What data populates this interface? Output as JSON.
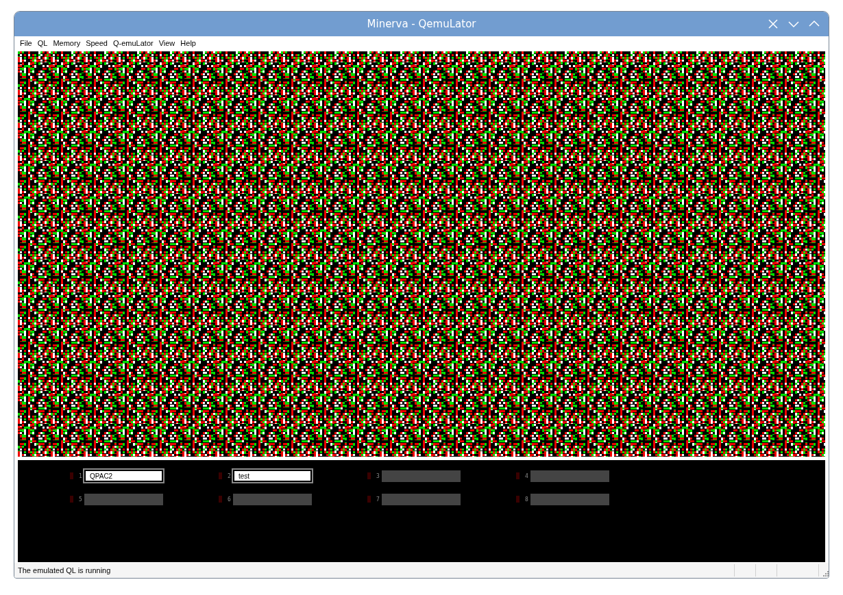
{
  "window": {
    "title": "Minerva - QemuLator"
  },
  "menu": [
    "File",
    "QL",
    "Memory",
    "Speed",
    "Q-emuLator",
    "View",
    "Help"
  ],
  "drives": [
    {
      "number": "1",
      "mounted": true,
      "name": "QPAC2",
      "active": false
    },
    {
      "number": "2",
      "mounted": true,
      "name": "test",
      "active": false
    },
    {
      "number": "3",
      "mounted": false,
      "active": false
    },
    {
      "number": "4",
      "mounted": false,
      "active": false
    },
    {
      "number": "5",
      "mounted": false,
      "active": false
    },
    {
      "number": "6",
      "mounted": false,
      "active": false
    },
    {
      "number": "7",
      "mounted": false,
      "active": false
    },
    {
      "number": "8",
      "mounted": false,
      "active": false
    }
  ],
  "status_bar": {
    "text": "The emulated QL is running"
  }
}
